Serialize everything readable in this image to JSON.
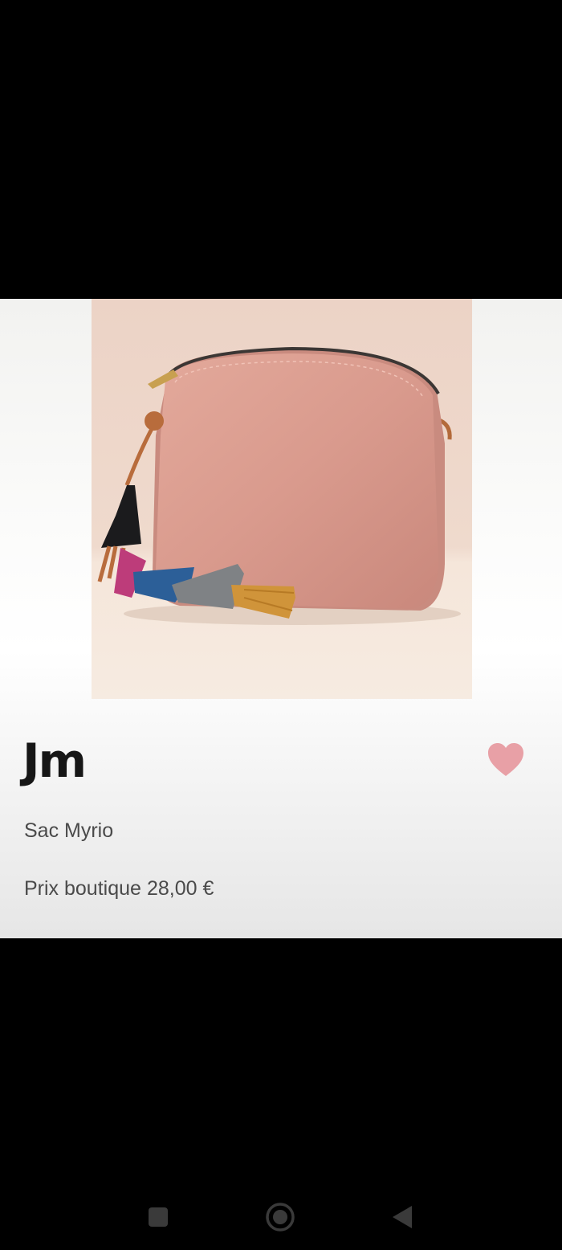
{
  "product": {
    "brand": "Jm",
    "name": "Sac Myrio",
    "price_label": "Prix boutique",
    "price": "28,00 €",
    "favorite": true,
    "image": "pink-crossbody-bag-with-tassels"
  },
  "colors": {
    "heart": "#e8a0a6",
    "bag": "#d99a8e",
    "text_dark": "#161616",
    "text_muted": "#4a4a4a"
  },
  "icons": {
    "favorite": "heart-icon",
    "nav_recents": "square-icon",
    "nav_home": "circle-icon",
    "nav_back": "triangle-left-icon"
  }
}
